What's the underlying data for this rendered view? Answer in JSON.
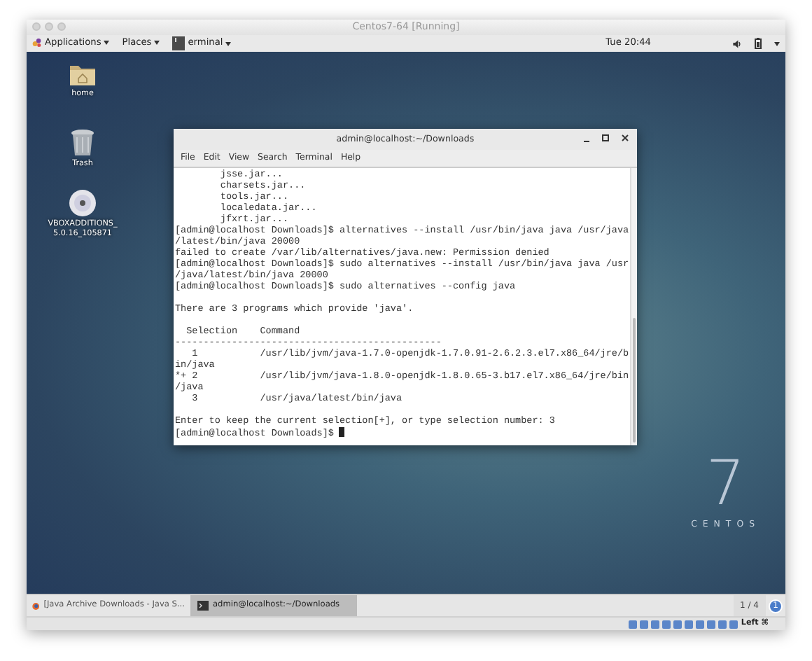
{
  "host_window": {
    "title": "Centos7-64 [Running]"
  },
  "top_bar": {
    "menus": [
      {
        "label": "Applications",
        "kind": "apps"
      },
      {
        "label": "Places",
        "kind": "plain"
      },
      {
        "label": "erminal",
        "kind": "app"
      }
    ],
    "clock": "Tue 20:44"
  },
  "desktop_icons": [
    {
      "label": "home",
      "kind": "folder"
    },
    {
      "label": "Trash",
      "kind": "trash"
    },
    {
      "label": "VBOXADDITIONS_ 5.0.16_105871",
      "kind": "disc"
    }
  ],
  "terminal": {
    "title": "admin@localhost:~/Downloads",
    "menu": [
      "File",
      "Edit",
      "View",
      "Search",
      "Terminal",
      "Help"
    ],
    "blocks": [
      [
        "        jsse.jar...",
        "        charsets.jar...",
        "        tools.jar...",
        "        localedata.jar...",
        "        jfxrt.jar...",
        "[admin@localhost Downloads]$ alternatives --install /usr/bin/java java /usr/java",
        "/latest/bin/java 20000",
        "failed to create /var/lib/alternatives/java.new: Permission denied",
        "[admin@localhost Downloads]$ sudo alternatives --install /usr/bin/java java /usr",
        "/java/latest/bin/java 20000",
        "[admin@localhost Downloads]$ sudo alternatives --config java"
      ],
      [
        "There are 3 programs which provide 'java'."
      ],
      [
        "  Selection    Command",
        "-----------------------------------------------",
        "   1           /usr/lib/jvm/java-1.7.0-openjdk-1.7.0.91-2.6.2.3.el7.x86_64/jre/b",
        "in/java",
        "*+ 2           /usr/lib/jvm/java-1.8.0-openjdk-1.8.0.65-3.b17.el7.x86_64/jre/bin",
        "/java",
        "   3           /usr/java/latest/bin/java"
      ],
      [
        "Enter to keep the current selection[+], or type selection number: 3",
        "[admin@localhost Downloads]$ "
      ]
    ]
  },
  "branding": {
    "number": "7",
    "word": "CENTOS"
  },
  "taskbar": {
    "tasks": [
      {
        "label": "[Java Archive Downloads - Java S...",
        "kind": "browser",
        "selected": false
      },
      {
        "label": "admin@localhost:~/Downloads",
        "kind": "terminal",
        "selected": true
      }
    ],
    "workspace": "1 / 4",
    "notification": "1"
  },
  "status_bar": {
    "host_key": "Left ⌘"
  }
}
